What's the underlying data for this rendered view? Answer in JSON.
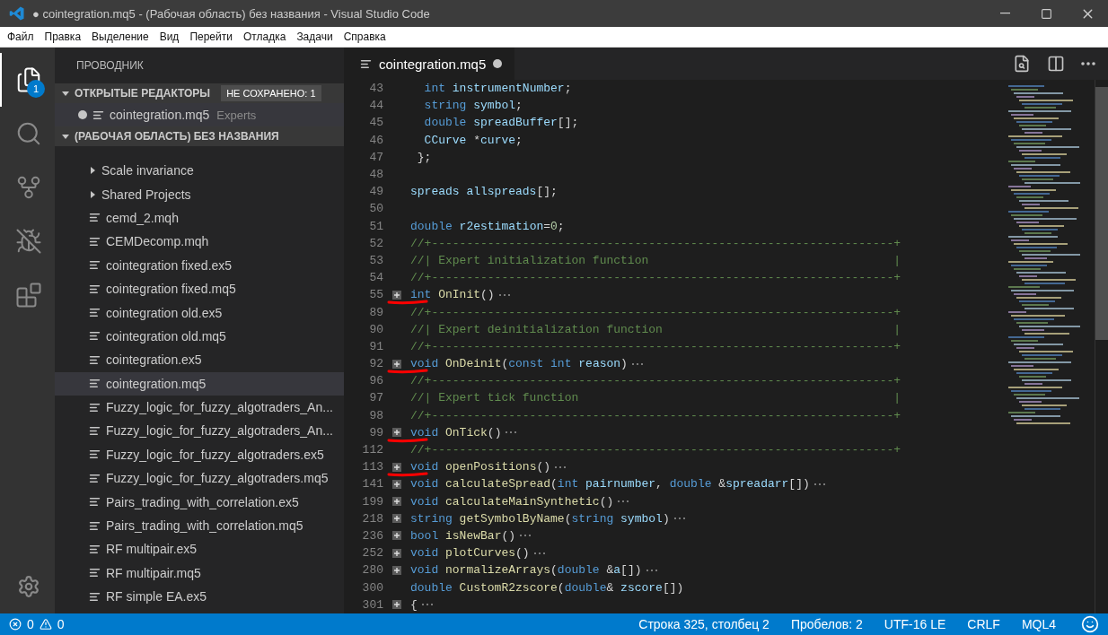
{
  "window": {
    "title": "● cointegration.mq5 - (Рабочая область) без названия - Visual Studio Code"
  },
  "menu": [
    {
      "label": "Файл"
    },
    {
      "label": "Правка"
    },
    {
      "label": "Выделение"
    },
    {
      "label": "Вид"
    },
    {
      "label": "Перейти"
    },
    {
      "label": "Отладка"
    },
    {
      "label": "Задачи"
    },
    {
      "label": "Справка"
    }
  ],
  "activity_bar": [
    {
      "kind": "files",
      "selected": true,
      "badge": "1"
    },
    {
      "kind": "search",
      "selected": false
    },
    {
      "kind": "scm",
      "selected": false
    },
    {
      "kind": "debug",
      "selected": false
    },
    {
      "kind": "extensions",
      "selected": false
    }
  ],
  "sidebar": {
    "title": "ПРОВОДНИК",
    "open_editors": {
      "title": "ОТКРЫТЫЕ РЕДАКТОРЫ",
      "expanded": true,
      "badge": "НЕ СОХРАНЕНО: 1",
      "items": [
        {
          "name": "cointegration.mq5",
          "description": "Experts",
          "modified": true,
          "selected": true
        }
      ]
    },
    "workspace": {
      "title": "(РАБОЧАЯ ОБЛАСТЬ) БЕЗ НАЗВАНИЯ",
      "expanded": true,
      "items": [
        {
          "kind": "folder",
          "name": "Scale invariance",
          "expanded": false,
          "selected": false
        },
        {
          "kind": "folder",
          "name": "Shared Projects",
          "expanded": false,
          "selected": false
        },
        {
          "kind": "file",
          "name": "cemd_2.mqh",
          "selected": false
        },
        {
          "kind": "file",
          "name": "CEMDecomp.mqh",
          "selected": false
        },
        {
          "kind": "file",
          "name": "cointegration fixed.ex5",
          "selected": false
        },
        {
          "kind": "file",
          "name": "cointegration fixed.mq5",
          "selected": false
        },
        {
          "kind": "file",
          "name": "cointegration old.ex5",
          "selected": false
        },
        {
          "kind": "file",
          "name": "cointegration old.mq5",
          "selected": false
        },
        {
          "kind": "file",
          "name": "cointegration.ex5",
          "selected": false
        },
        {
          "kind": "file",
          "name": "cointegration.mq5",
          "selected": true
        },
        {
          "kind": "file",
          "name": "Fuzzy_logic_for_fuzzy_algotraders_An...",
          "selected": false
        },
        {
          "kind": "file",
          "name": "Fuzzy_logic_for_fuzzy_algotraders_An...",
          "selected": false
        },
        {
          "kind": "file",
          "name": "Fuzzy_logic_for_fuzzy_algotraders.ex5",
          "selected": false
        },
        {
          "kind": "file",
          "name": "Fuzzy_logic_for_fuzzy_algotraders.mq5",
          "selected": false
        },
        {
          "kind": "file",
          "name": "Pairs_trading_with_correlation.ex5",
          "selected": false
        },
        {
          "kind": "file",
          "name": "Pairs_trading_with_correlation.mq5",
          "selected": false
        },
        {
          "kind": "file",
          "name": "RF multipair.ex5",
          "selected": false
        },
        {
          "kind": "file",
          "name": "RF multipair.mq5",
          "selected": false
        },
        {
          "kind": "file",
          "name": "RF simple EA.ex5",
          "selected": false
        }
      ]
    }
  },
  "editor": {
    "tabs": [
      {
        "label": "cointegration.mq5",
        "modified": true,
        "selected": true
      }
    ],
    "lines": [
      {
        "number": "43",
        "tokens": [
          {
            "kind": "kw",
            "t": "  int"
          },
          {
            "kind": "var",
            "t": " instrumentNumber"
          },
          {
            "kind": "p",
            "t": ";"
          }
        ]
      },
      {
        "number": "44",
        "tokens": [
          {
            "kind": "kw",
            "t": "  string"
          },
          {
            "kind": "var",
            "t": " symbol"
          },
          {
            "kind": "p",
            "t": ";"
          }
        ]
      },
      {
        "number": "45",
        "tokens": [
          {
            "kind": "kw",
            "t": "  double"
          },
          {
            "kind": "var",
            "t": " spreadBuffer"
          },
          {
            "kind": "p",
            "t": "[];"
          }
        ]
      },
      {
        "number": "46",
        "tokens": [
          {
            "kind": "var",
            "t": "  CCurve"
          },
          {
            "kind": "p",
            "t": " *"
          },
          {
            "kind": "var",
            "t": "curve"
          },
          {
            "kind": "p",
            "t": ";"
          }
        ]
      },
      {
        "number": "47",
        "tokens": [
          {
            "kind": "p",
            "t": " };"
          }
        ]
      },
      {
        "number": "48"
      },
      {
        "number": "49",
        "tokens": [
          {
            "kind": "var",
            "t": "spreads"
          },
          {
            "kind": "var",
            "t": " allspreads"
          },
          {
            "kind": "p",
            "t": "[];"
          }
        ]
      },
      {
        "number": "50"
      },
      {
        "number": "51",
        "tokens": [
          {
            "kind": "kw",
            "t": "double"
          },
          {
            "kind": "var",
            "t": " r2estimation"
          },
          {
            "kind": "p",
            "t": "="
          },
          {
            "kind": "num",
            "t": "0"
          },
          {
            "kind": "p",
            "t": ";"
          }
        ]
      },
      {
        "number": "52",
        "tokens": [
          {
            "kind": "com",
            "t": "//+------------------------------------------------------------------+"
          }
        ]
      },
      {
        "number": "53",
        "tokens": [
          {
            "kind": "com",
            "t": "//| Expert initialization function                                   |"
          }
        ]
      },
      {
        "number": "54",
        "tokens": [
          {
            "kind": "com",
            "t": "//+------------------------------------------------------------------+"
          }
        ]
      },
      {
        "number": "55",
        "folded": true,
        "marked": true,
        "tokens": [
          {
            "kind": "kw",
            "t": "int"
          },
          {
            "kind": "fn",
            "t": " OnInit"
          },
          {
            "kind": "p",
            "t": "()"
          }
        ]
      },
      {
        "number": "89",
        "tokens": [
          {
            "kind": "com",
            "t": "//+------------------------------------------------------------------+"
          }
        ]
      },
      {
        "number": "90",
        "tokens": [
          {
            "kind": "com",
            "t": "//| Expert deinitialization function                                 |"
          }
        ]
      },
      {
        "number": "91",
        "tokens": [
          {
            "kind": "com",
            "t": "//+------------------------------------------------------------------+"
          }
        ]
      },
      {
        "number": "92",
        "folded": true,
        "marked": true,
        "tokens": [
          {
            "kind": "kw",
            "t": "void"
          },
          {
            "kind": "fn",
            "t": " OnDeinit"
          },
          {
            "kind": "p",
            "t": "("
          },
          {
            "kind": "kw",
            "t": "const"
          },
          {
            "kind": "kw",
            "t": " int"
          },
          {
            "kind": "var",
            "t": " reason"
          },
          {
            "kind": "p",
            "t": ")"
          }
        ]
      },
      {
        "number": "96",
        "tokens": [
          {
            "kind": "com",
            "t": "//+------------------------------------------------------------------+"
          }
        ]
      },
      {
        "number": "97",
        "tokens": [
          {
            "kind": "com",
            "t": "//| Expert tick function                                             |"
          }
        ]
      },
      {
        "number": "98",
        "tokens": [
          {
            "kind": "com",
            "t": "//+------------------------------------------------------------------+"
          }
        ]
      },
      {
        "number": "99",
        "folded": true,
        "marked": true,
        "tokens": [
          {
            "kind": "kw",
            "t": "void"
          },
          {
            "kind": "fn",
            "t": " OnTick"
          },
          {
            "kind": "p",
            "t": "()"
          }
        ]
      },
      {
        "number": "112",
        "tokens": [
          {
            "kind": "com",
            "t": "//+------------------------------------------------------------------+"
          }
        ]
      },
      {
        "number": "113",
        "folded": true,
        "marked": true,
        "tokens": [
          {
            "kind": "kw",
            "t": "void"
          },
          {
            "kind": "fn",
            "t": " openPositions"
          },
          {
            "kind": "p",
            "t": "()"
          }
        ]
      },
      {
        "number": "141",
        "folded": true,
        "tokens": [
          {
            "kind": "kw",
            "t": "void"
          },
          {
            "kind": "fn",
            "t": " calculateSpread"
          },
          {
            "kind": "p",
            "t": "("
          },
          {
            "kind": "kw",
            "t": "int"
          },
          {
            "kind": "var",
            "t": " pairnumber"
          },
          {
            "kind": "p",
            "t": ", "
          },
          {
            "kind": "kw",
            "t": "double"
          },
          {
            "kind": "p",
            "t": " &"
          },
          {
            "kind": "var",
            "t": "spreadarr"
          },
          {
            "kind": "p",
            "t": "[])"
          }
        ]
      },
      {
        "number": "199",
        "folded": true,
        "tokens": [
          {
            "kind": "kw",
            "t": "void"
          },
          {
            "kind": "fn",
            "t": " calculateMainSynthetic"
          },
          {
            "kind": "p",
            "t": "()"
          }
        ]
      },
      {
        "number": "218",
        "folded": true,
        "tokens": [
          {
            "kind": "kw",
            "t": "string"
          },
          {
            "kind": "fn",
            "t": " getSymbolByName"
          },
          {
            "kind": "p",
            "t": "("
          },
          {
            "kind": "kw",
            "t": "string"
          },
          {
            "kind": "var",
            "t": " symbol"
          },
          {
            "kind": "p",
            "t": ")"
          }
        ]
      },
      {
        "number": "236",
        "folded": true,
        "tokens": [
          {
            "kind": "kw",
            "t": "bool"
          },
          {
            "kind": "fn",
            "t": " isNewBar"
          },
          {
            "kind": "p",
            "t": "()"
          }
        ]
      },
      {
        "number": "252",
        "folded": true,
        "tokens": [
          {
            "kind": "kw",
            "t": "void"
          },
          {
            "kind": "fn",
            "t": " plotCurves"
          },
          {
            "kind": "p",
            "t": "()"
          }
        ]
      },
      {
        "number": "280",
        "folded": true,
        "tokens": [
          {
            "kind": "kw",
            "t": "void"
          },
          {
            "kind": "fn",
            "t": " normalizeArrays"
          },
          {
            "kind": "p",
            "t": "("
          },
          {
            "kind": "kw",
            "t": "double"
          },
          {
            "kind": "p",
            "t": " &"
          },
          {
            "kind": "var",
            "t": "a"
          },
          {
            "kind": "p",
            "t": "[])"
          }
        ]
      },
      {
        "number": "300",
        "tokens": [
          {
            "kind": "kw",
            "t": "double"
          },
          {
            "kind": "fn",
            "t": " CustomR2zscore"
          },
          {
            "kind": "p",
            "t": "("
          },
          {
            "kind": "kw",
            "t": "double"
          },
          {
            "kind": "p",
            "t": "& "
          },
          {
            "kind": "var",
            "t": "zscore"
          },
          {
            "kind": "p",
            "t": "[])"
          }
        ]
      },
      {
        "number": "301",
        "folded": true,
        "tokens": [
          {
            "kind": "p",
            "t": "{"
          }
        ]
      }
    ]
  },
  "status_bar": {
    "errors": "0",
    "warnings": "0",
    "items": [
      "Строка 325, столбец 2",
      "Пробелов: 2",
      "UTF-16 LE",
      "CRLF",
      "MQL4"
    ]
  }
}
